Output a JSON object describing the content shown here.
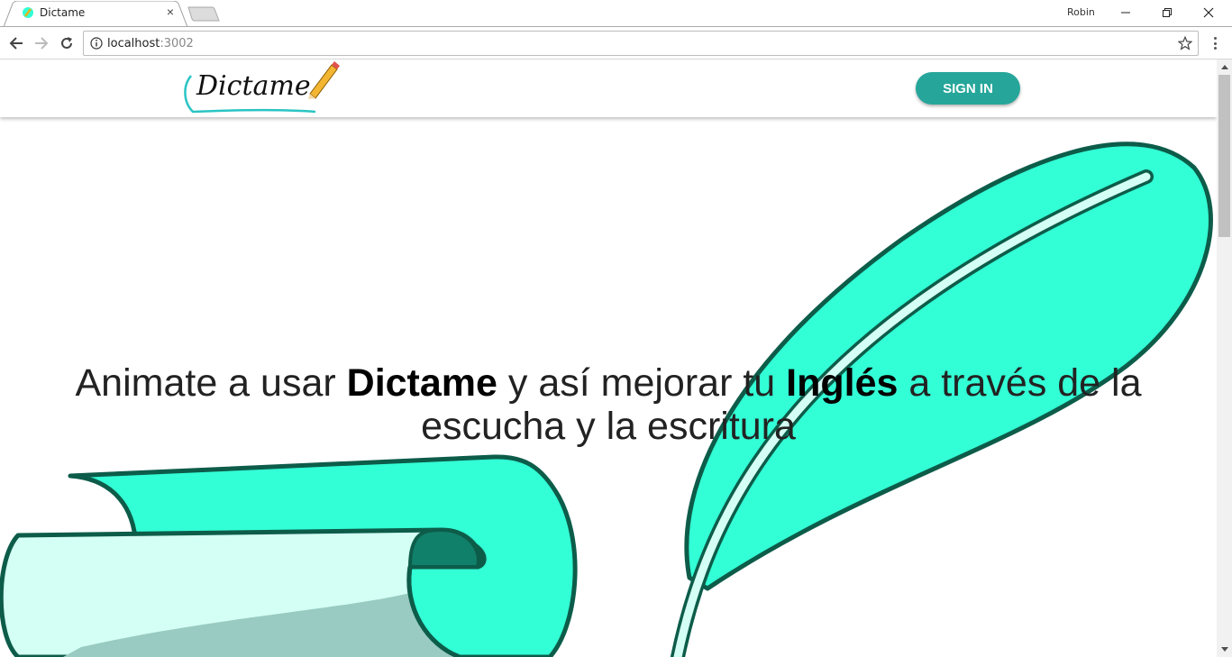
{
  "browser": {
    "tab_title": "Dictame",
    "tab_close": "×",
    "profile_name": "Robin",
    "url_host": "localhost",
    "url_port": ":3002"
  },
  "header": {
    "logo_text": "Dictame",
    "signin_label": "SIGN IN"
  },
  "hero": {
    "part1": "Animate a usar ",
    "bold1": "Dictame",
    "part2": " y así mejorar tu ",
    "bold2": "Inglés",
    "part3": " a través de la escucha y la escritura"
  },
  "colors": {
    "accent": "#26a69a",
    "art_fill": "#33ffd6",
    "art_outline": "#0d5c4a",
    "paper_light": "#d4fff4"
  },
  "icons": [
    "tab-favicon-icon",
    "close-icon",
    "back-arrow-icon",
    "forward-arrow-icon",
    "reload-icon",
    "info-icon",
    "star-icon",
    "menu-icon",
    "minimize-icon",
    "maximize-icon",
    "window-close-icon",
    "pencil-icon",
    "feather-icon",
    "scroll-icon"
  ]
}
